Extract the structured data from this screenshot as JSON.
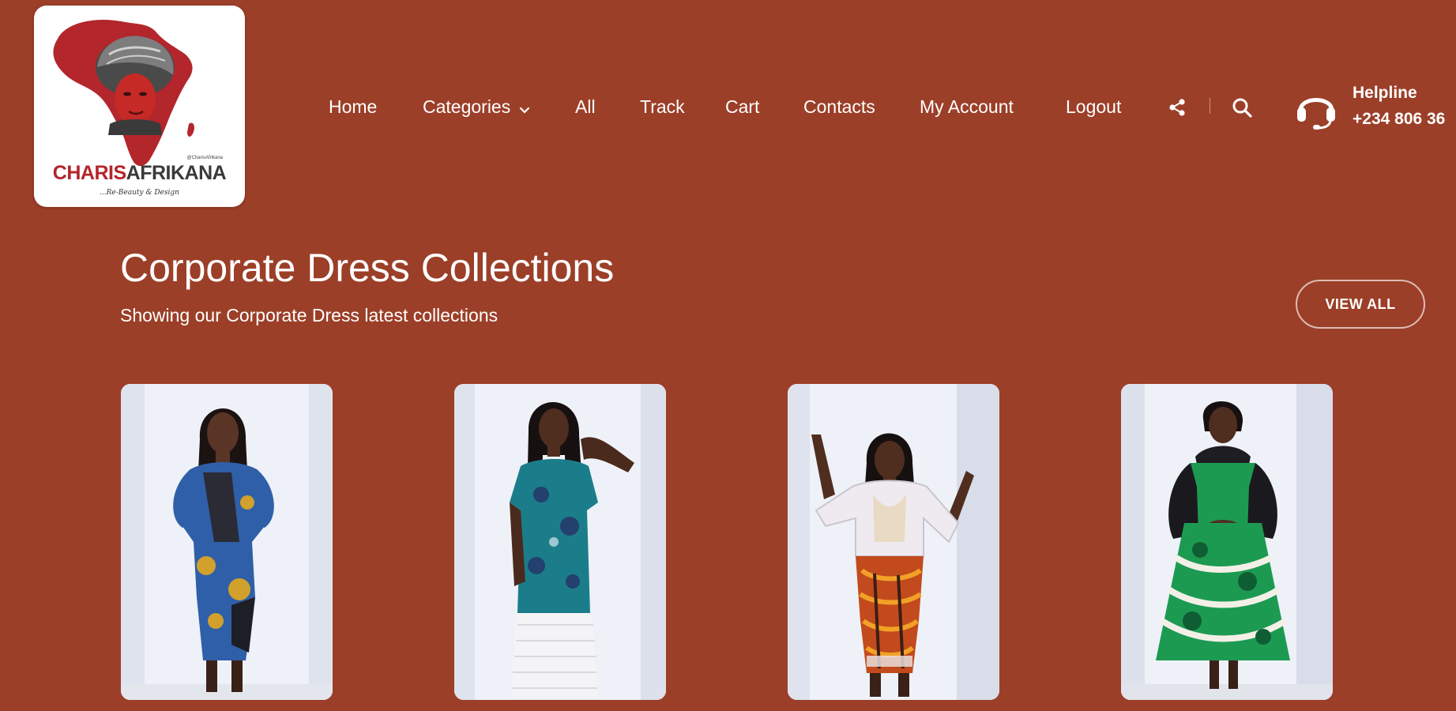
{
  "logo": {
    "wordmark_part1": "CHARIS",
    "wordmark_part2": "AFRIKANA",
    "handle": "@CharisAfrikana",
    "tagline": "...Re-Beauty & Design"
  },
  "nav": {
    "items": [
      {
        "label": "Home"
      },
      {
        "label": "Categories"
      },
      {
        "label": "All"
      },
      {
        "label": "Track"
      },
      {
        "label": "Cart"
      },
      {
        "label": "Contacts"
      },
      {
        "label": "My Account"
      },
      {
        "label": "Logout"
      }
    ],
    "icons": [
      "share-icon",
      "search-icon",
      "headset-icon",
      "chevron-down-icon"
    ]
  },
  "helpline": {
    "label": "Helpline",
    "number": "+234 806 36"
  },
  "section": {
    "title": "Corporate Dress Collections",
    "subtitle": "Showing our Corporate Dress latest collections",
    "view_all": "VIEW ALL"
  },
  "products": [
    {
      "image": "model-blue-ankara-dress"
    },
    {
      "image": "model-teal-ankara-top-lace-skirt"
    },
    {
      "image": "model-sheer-blouse-orange-skirt"
    },
    {
      "image": "model-green-ankara-flare-dress"
    }
  ],
  "colors": {
    "background": "#9c3f28",
    "text": "#ffffff",
    "brand_red": "#b3262c"
  }
}
